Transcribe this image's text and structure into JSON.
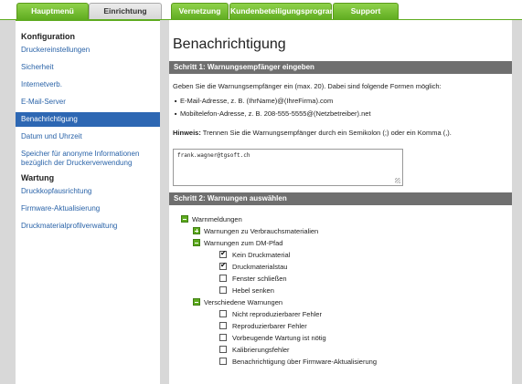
{
  "tabs": [
    {
      "label": "Hauptmenü",
      "active": false
    },
    {
      "label": "Einrichtung",
      "active": true
    },
    {
      "label": "Vernetzung",
      "active": false
    },
    {
      "label": "Kundenbeteiligungsprogramm",
      "active": false
    },
    {
      "label": "Support",
      "active": false
    }
  ],
  "sidebar": {
    "heading_config": "Konfiguration",
    "config_items": [
      "Druckereinstellungen",
      "Sicherheit",
      "Internetverb.",
      "E-Mail-Server",
      "Benachrichtigung",
      "Datum und Uhrzeit",
      "Speicher für anonyme Informationen",
      "bezüglich der Druckerverwendung"
    ],
    "heading_maintenance": "Wartung",
    "maintenance_items": [
      "Druckkopfausrichtung",
      "Firmware-Aktualisierung",
      "Druckmaterialprofilverwaltung"
    ],
    "active_item": "Benachrichtigung"
  },
  "main": {
    "title": "Benachrichtigung",
    "step1": {
      "header": "Schritt 1: Warnungsempfänger eingeben",
      "intro": "Geben Sie die Warnungsempfänger ein (max. 20). Dabei sind folgende Formen möglich:",
      "bullets": [
        "E-Mail-Adresse, z. B. (IhrName)@(IhreFirma).com",
        "Mobiltelefon-Adresse, z. B. 208-555-5555@(Netzbetreiber).net"
      ],
      "hint_label": "Hinweis:",
      "hint_text": " Trennen Sie die Warnungsempfänger durch ein Semikolon (;) oder ein Komma (,).",
      "recipients_value": "frank.wagner@tgsoft.ch"
    },
    "step2": {
      "header": "Schritt 2: Warnungen auswählen",
      "root": "Warnmeldungen",
      "group_consumables": "Warnungen zu Verbrauchsmaterialien",
      "group_dm": "Warnungen zum DM-Pfad",
      "dm_items": [
        {
          "label": "Kein Druckmaterial",
          "checked": true
        },
        {
          "label": "Druckmaterialstau",
          "checked": true
        },
        {
          "label": "Fenster schließen",
          "checked": false
        },
        {
          "label": "Hebel senken",
          "checked": false
        }
      ],
      "group_misc": "Verschiedene Warnungen",
      "misc_items": [
        {
          "label": "Nicht reproduzierbarer Fehler",
          "checked": false
        },
        {
          "label": "Reproduzierbarer Fehler",
          "checked": false
        },
        {
          "label": "Vorbeugende Wartung ist nötig",
          "checked": false
        },
        {
          "label": "Kalibrierungsfehler",
          "checked": false
        },
        {
          "label": "Benachrichtigung über Firmware-Aktualisierung",
          "checked": false
        }
      ]
    }
  }
}
